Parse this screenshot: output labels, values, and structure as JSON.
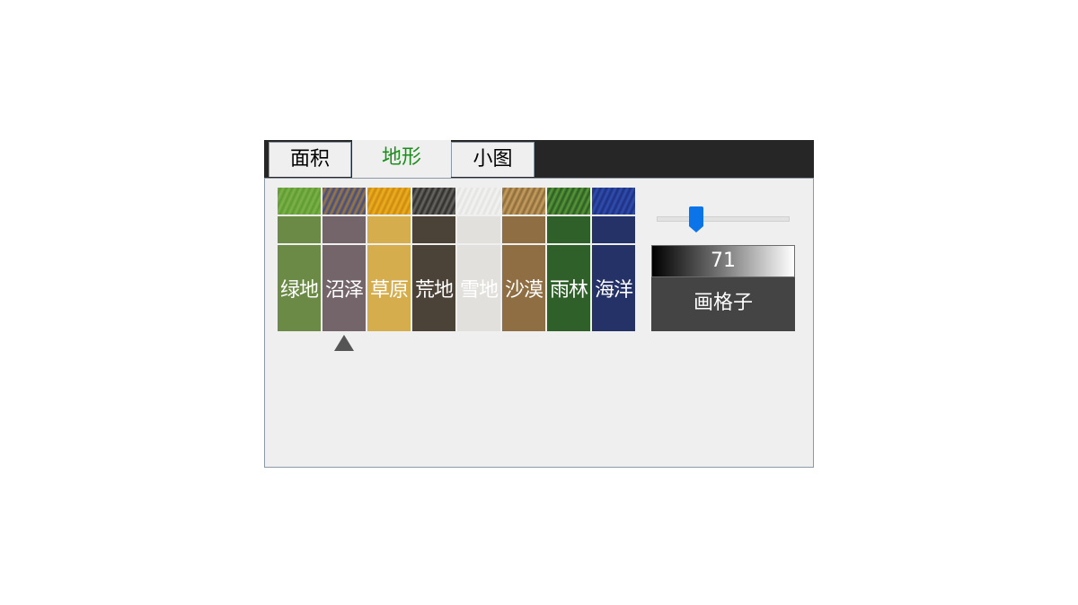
{
  "tabs": [
    {
      "label": "面积"
    },
    {
      "label": "地形"
    },
    {
      "label": "小图"
    }
  ],
  "terrains": [
    {
      "label": "绿地",
      "color": "#6b8a46",
      "texture": [
        "#7fb24a",
        "#5c9b30"
      ]
    },
    {
      "label": "沼泽",
      "color": "#736569",
      "texture": [
        "#3f4a8a",
        "#a07b3a"
      ]
    },
    {
      "label": "草原",
      "color": "#d5ad4d",
      "texture": [
        "#f0b020",
        "#c98a10"
      ]
    },
    {
      "label": "荒地",
      "color": "#4c4338",
      "texture": [
        "#6a6a66",
        "#2e2b28"
      ]
    },
    {
      "label": "雪地",
      "color": "#e1e0dc",
      "texture": [
        "#f4f4f2",
        "#e3e3e1"
      ]
    },
    {
      "label": "沙漠",
      "color": "#8f6e43",
      "texture": [
        "#c9a060",
        "#8a6a3a"
      ]
    },
    {
      "label": "雨林",
      "color": "#30602a",
      "texture": [
        "#5a9a3a",
        "#2a5a22"
      ]
    },
    {
      "label": "海洋",
      "color": "#243268",
      "texture": [
        "#3050b0",
        "#1e2f80"
      ]
    }
  ],
  "selected_terrain_index": 1,
  "slider": {
    "fraction": 0.3
  },
  "value_box": {
    "value": "71"
  },
  "draw_button": {
    "label": "画格子"
  },
  "accent": "#0a74e8"
}
